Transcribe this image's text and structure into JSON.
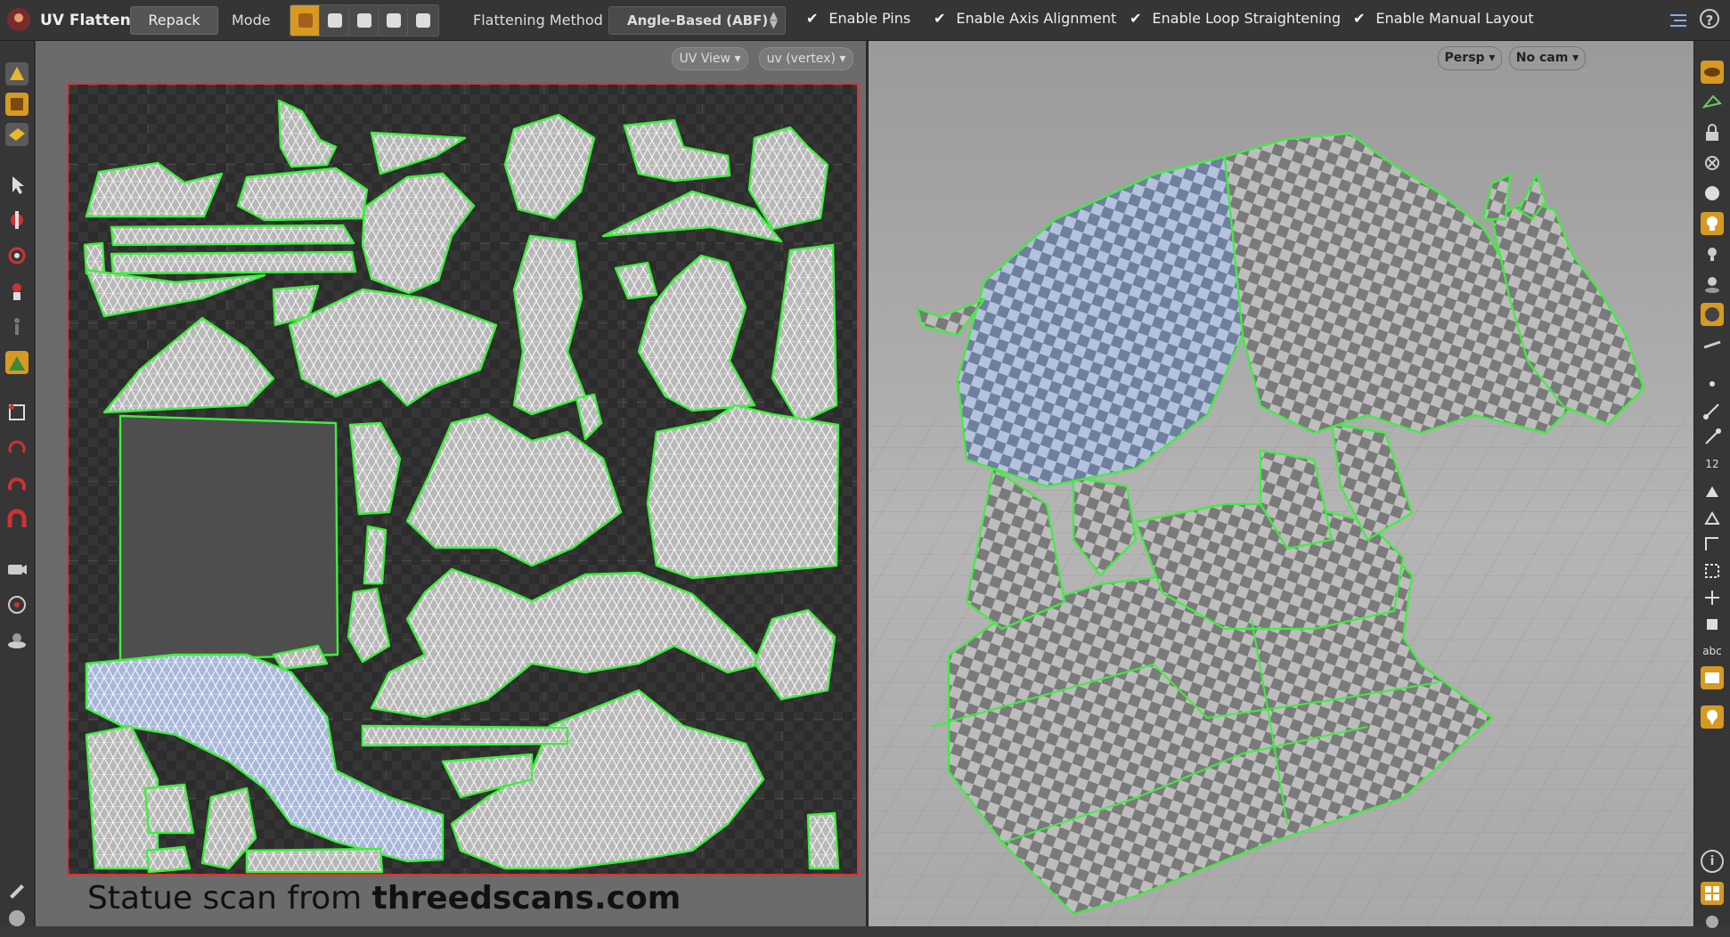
{
  "toolbar": {
    "tool_name": "UV Flatten",
    "repack_label": "Repack",
    "mode_label": "Mode",
    "method_label": "Flattening Method",
    "method_value": "Angle-Based (ABF)",
    "checks": [
      {
        "label": "Enable Pins",
        "checked": true
      },
      {
        "label": "Enable Axis Alignment",
        "checked": true
      },
      {
        "label": "Enable Loop Straightening",
        "checked": true
      },
      {
        "label": "Enable Manual Layout",
        "checked": true
      }
    ],
    "help_label": "?"
  },
  "uv_view": {
    "view_label": "UV View ▾",
    "attr_label": "uv (vertex) ▾"
  },
  "viewport": {
    "persp_label": "Persp ▾",
    "cam_label": "No cam ▾"
  },
  "caption": {
    "prefix": "Statue scan from ",
    "site": "threedscans.com"
  },
  "right_shelf": {
    "num_label": "12",
    "abc_label": "abc",
    "info_label": "i"
  },
  "colors": {
    "accent": "#d69a22",
    "seam": "#3cf03c",
    "uv_border": "#e23030",
    "selection": "#a9b8d8"
  }
}
